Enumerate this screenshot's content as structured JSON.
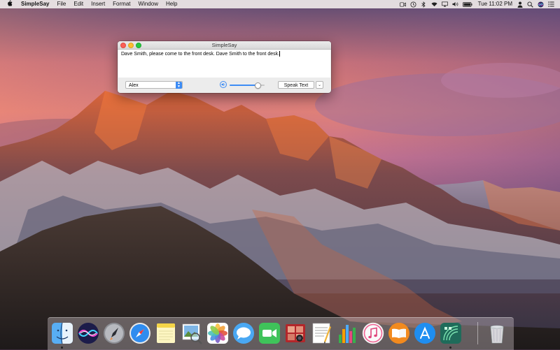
{
  "menubar": {
    "apple": "",
    "app_name": "SimpleSay",
    "menus": [
      "File",
      "Edit",
      "Insert",
      "Format",
      "Window",
      "Help"
    ],
    "clock": "Tue 11:02 PM",
    "status_icons": [
      "facetime-camera-icon",
      "time-machine-icon",
      "bluetooth-icon",
      "wifi-icon",
      "airplay-icon",
      "volume-icon",
      "battery-icon",
      "user-icon",
      "spotlight-icon",
      "siri-icon",
      "notification-center-icon"
    ]
  },
  "window": {
    "title": "SimpleSay",
    "text": "Dave Smith, please come to the front desk.  Dave Smith to the front desk.",
    "voice": "Alex",
    "volume_fraction": 0.78,
    "speak_label": "Speak Text"
  },
  "dock": {
    "apps": [
      "Finder",
      "Siri",
      "Launchpad",
      "Safari",
      "Notes",
      "Preview",
      "Photos",
      "Messages",
      "FaceTime",
      "Photo Booth",
      "TextEdit",
      "Numbers",
      "iTunes",
      "iBooks",
      "App Store",
      "Network Radar"
    ],
    "trash": "Trash"
  },
  "colors": {
    "accent": "#3d8cf5",
    "close": "#fc5f57",
    "minimize": "#fdbd2e",
    "zoom": "#28c840"
  }
}
